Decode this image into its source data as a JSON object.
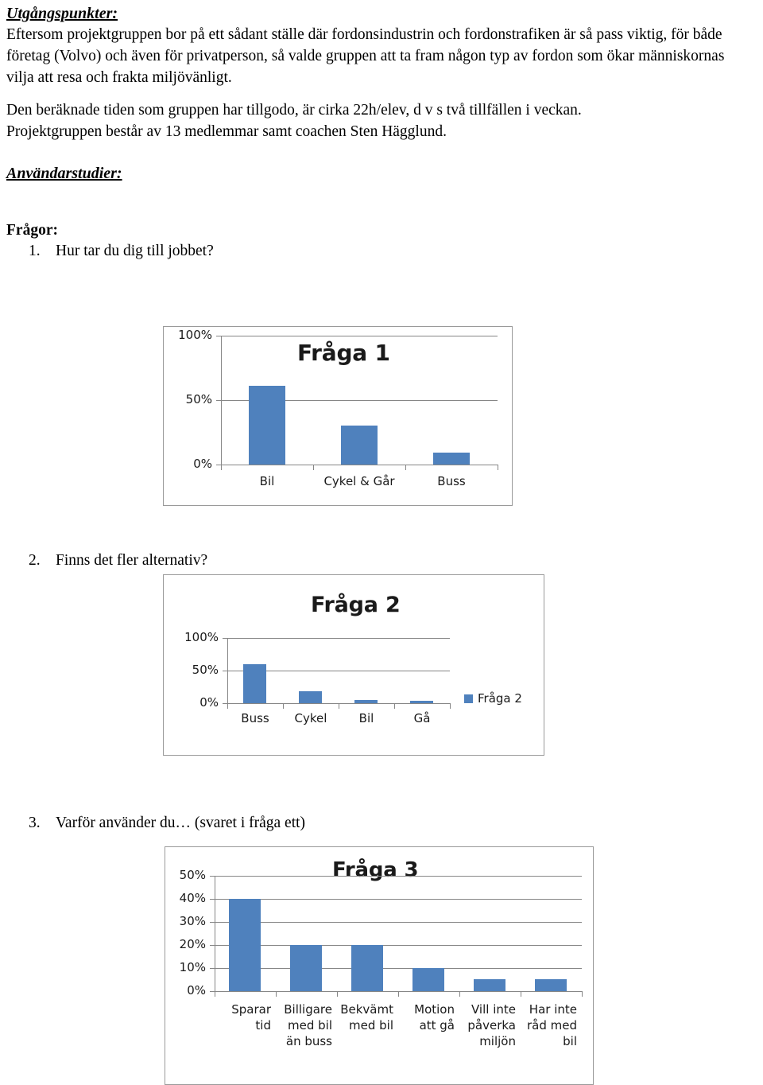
{
  "document": {
    "section1_heading": "Utgångspunkter:",
    "section1_paragraph1": "Eftersom projektgruppen bor på ett sådant ställe där fordonsindustrin och fordonstrafiken är så pass viktig, för både företag (Volvo) och även för privatperson, så valde gruppen att ta fram någon typ av fordon som ökar människornas vilja att resa och frakta miljövänligt.",
    "section1_paragraph2_line1": "Den beräknade tiden som gruppen har tillgodo, är cirka 22h/elev, d v s två tillfällen i veckan.",
    "section1_paragraph2_line2": "Projektgruppen består av 13 medlemmar samt coachen Sten Hägglund.",
    "section2_heading": "Användarstudier:",
    "questions_label": "Frågor:",
    "questions": [
      {
        "number": "1.",
        "text": "Hur tar du dig till jobbet?"
      },
      {
        "number": "2.",
        "text": "Finns det fler alternativ?"
      },
      {
        "number": "3.",
        "text": "Varför använder du… (svaret i fråga ett)"
      }
    ]
  },
  "colors": {
    "bar_blue": "#4f81bd",
    "grid_gray": "#868686",
    "frame_gray": "#9a9a9a"
  },
  "chart_data": [
    {
      "id": "fraga-1",
      "type": "bar",
      "title": "Fråga 1",
      "categories": [
        "Bil",
        "Cykel & Går",
        "Buss"
      ],
      "values": [
        61,
        30,
        9
      ],
      "ylabel": "",
      "xlabel": "",
      "ylim": [
        0,
        100
      ],
      "yticks": [
        0,
        50,
        100
      ],
      "ytick_labels": [
        "0%",
        "50%",
        "100%"
      ],
      "grid": true,
      "legend": null,
      "legend_position": "none"
    },
    {
      "id": "fraga-2",
      "type": "bar",
      "title": "Fråga 2",
      "categories": [
        "Buss",
        "Cykel",
        "Bil",
        "Gå"
      ],
      "values": [
        60,
        18,
        5,
        4
      ],
      "ylabel": "",
      "xlabel": "",
      "ylim": [
        0,
        100
      ],
      "yticks": [
        0,
        50,
        100
      ],
      "ytick_labels": [
        "0%",
        "50%",
        "100%"
      ],
      "grid": true,
      "legend": [
        "Fråga 2"
      ],
      "legend_position": "right"
    },
    {
      "id": "fraga-3",
      "type": "bar",
      "title": "Fråga 3",
      "categories": [
        "Sparar tid",
        "Billigare med bil än buss",
        "Bekvämt med bil",
        "Motion att gå",
        "Vill inte påverka miljön",
        "Har inte råd med bil"
      ],
      "category_lines": [
        [
          "Sparar tid"
        ],
        [
          "Billigare",
          "med bil",
          "än buss"
        ],
        [
          "Bekvämt",
          "med bil"
        ],
        [
          "Motion",
          "att gå"
        ],
        [
          "Vill inte",
          "påverka",
          "miljön"
        ],
        [
          "Har inte",
          "råd med",
          "bil"
        ]
      ],
      "values": [
        40,
        20,
        20,
        10,
        5,
        5
      ],
      "ylabel": "",
      "xlabel": "",
      "ylim": [
        0,
        50
      ],
      "yticks": [
        0,
        10,
        20,
        30,
        40,
        50
      ],
      "ytick_labels": [
        "0%",
        "10%",
        "20%",
        "30%",
        "40%",
        "50%"
      ],
      "grid": true,
      "legend": null,
      "legend_position": "none"
    }
  ]
}
